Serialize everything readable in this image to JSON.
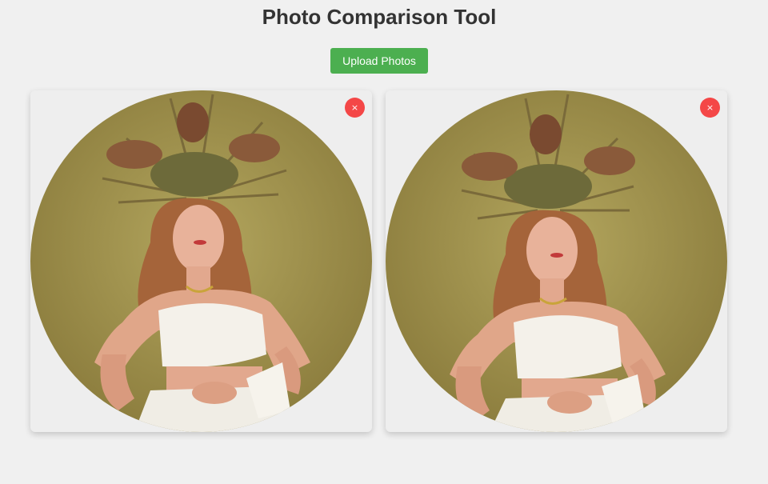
{
  "header": {
    "title": "Photo Comparison Tool"
  },
  "toolbar": {
    "upload_label": "Upload Photos"
  },
  "photos": [
    {
      "remove_label": "×",
      "remove_icon": "close-icon"
    },
    {
      "remove_label": "×",
      "remove_icon": "close-icon"
    }
  ],
  "colors": {
    "background": "#f0f0f0",
    "upload_button": "#4caf50",
    "remove_button": "#f44747",
    "photo_backdrop": "#a8984f"
  }
}
